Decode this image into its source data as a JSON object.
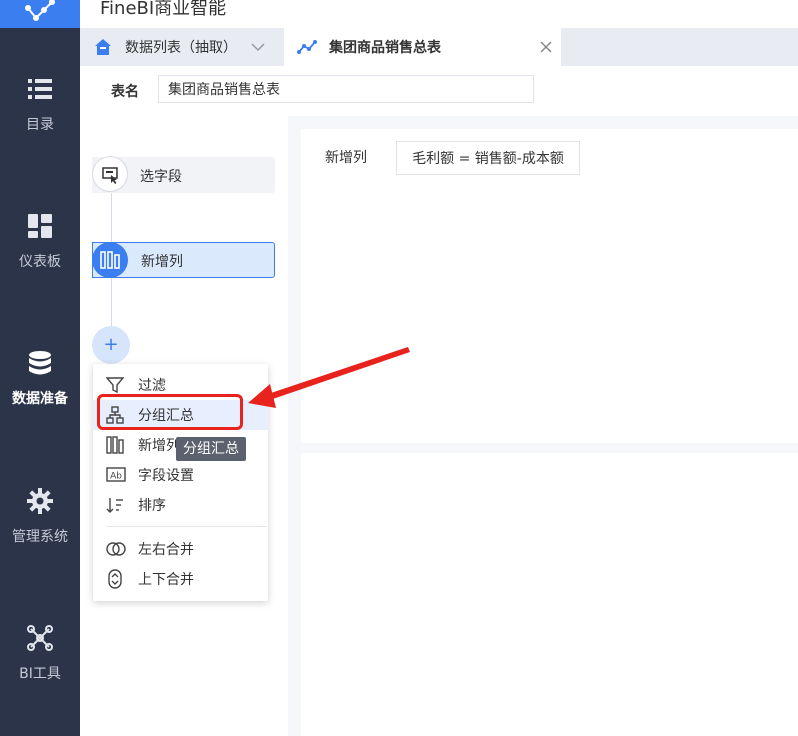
{
  "app": {
    "title": "FineBI商业智能"
  },
  "nav": {
    "items": [
      {
        "label": "目录",
        "icon": "list-icon"
      },
      {
        "label": "仪表板",
        "icon": "dashboard-icon"
      },
      {
        "label": "数据准备",
        "icon": "database-icon",
        "active": true
      },
      {
        "label": "管理系统",
        "icon": "gear-icon"
      },
      {
        "label": "BI工具",
        "icon": "bi-tools-icon"
      }
    ]
  },
  "tabs": [
    {
      "label": "数据列表（抽取）",
      "icon": "home-icon",
      "has_dropdown": true
    },
    {
      "label": "集团商品销售总表",
      "icon": "line-chart-icon",
      "active": true,
      "closable": true
    }
  ],
  "table_name": {
    "label": "表名",
    "value": "集团商品销售总表"
  },
  "steps": [
    {
      "label": "选字段",
      "icon": "select-field-icon"
    },
    {
      "label": "新增列",
      "icon": "add-column-icon",
      "active": true
    }
  ],
  "add_step": {
    "symbol": "+"
  },
  "menu": {
    "items": [
      {
        "label": "过滤",
        "icon": "filter-icon"
      },
      {
        "label": "分组汇总",
        "icon": "group-summary-icon",
        "hover": true
      },
      {
        "label": "新增列",
        "icon": "add-column-icon"
      },
      {
        "label": "字段设置",
        "icon": "field-settings-icon"
      },
      {
        "label": "排序",
        "icon": "sort-icon"
      },
      {
        "label": "左右合并",
        "icon": "horizontal-merge-icon"
      },
      {
        "label": "上下合并",
        "icon": "vertical-merge-icon"
      }
    ]
  },
  "tooltip": "分组汇总",
  "config": {
    "label": "新增列",
    "formula": "毛利额 = 销售额-成本额"
  },
  "colors": {
    "accent": "#3a7ef0",
    "nav_bg": "#2c3449",
    "highlight": "#e8231e"
  }
}
